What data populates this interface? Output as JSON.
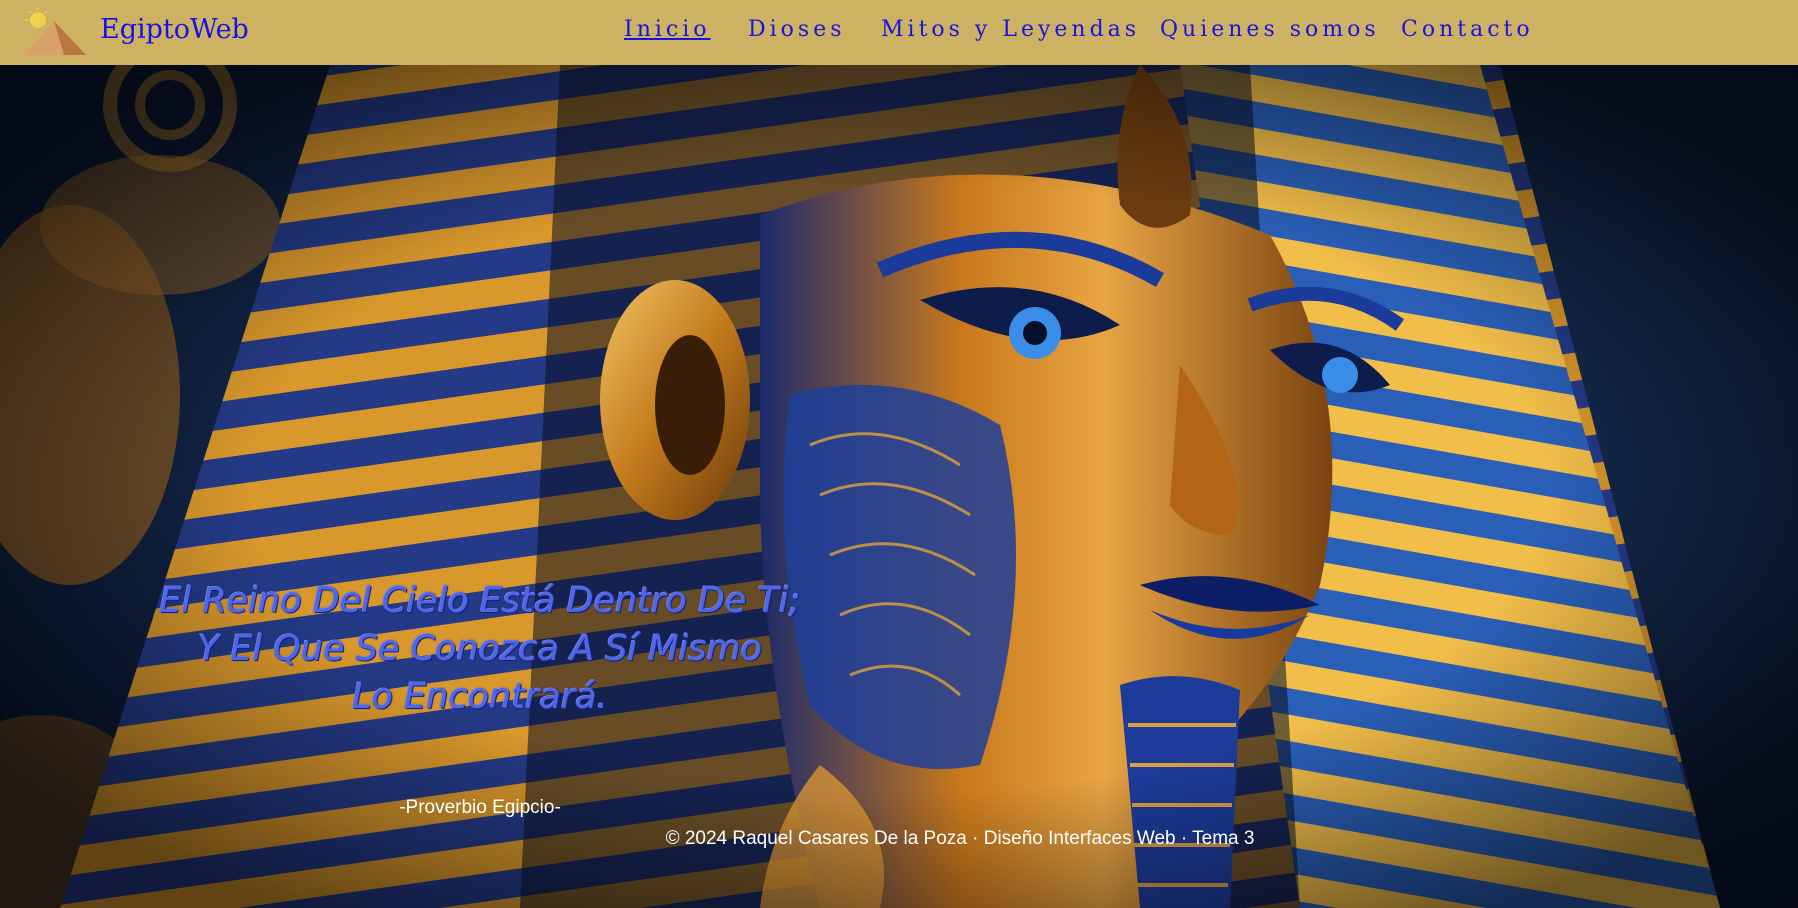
{
  "brand": {
    "name": "EgiptoWeb",
    "logo_icon": "pyramid-sun-icon"
  },
  "nav": {
    "items": [
      {
        "label": "Inicio",
        "active": true
      },
      {
        "label": "Dioses",
        "active": false
      },
      {
        "label": "Mitos y Leyendas",
        "active": false
      },
      {
        "label": "Quienes somos",
        "active": false
      },
      {
        "label": "Contacto",
        "active": false
      }
    ]
  },
  "hero": {
    "image": "pharaoh-mask-image",
    "quote_lines": [
      "El Reino Del Cielo Está Dentro De Ti;",
      "Y El Que Se Conozca A Sí Mismo",
      "Lo Encontrará."
    ],
    "quote_author": "-Proverbio Egipcio-"
  },
  "footer": {
    "text": "© 2024 Raquel Casares De la Poza · Diseño Interfaces Web · Tema 3"
  },
  "colors": {
    "header_bg": "#cdb264",
    "link": "#1a12e0",
    "quote": "#5066e8",
    "gold": "#d99a2b",
    "lapis": "#1f3f8f"
  }
}
